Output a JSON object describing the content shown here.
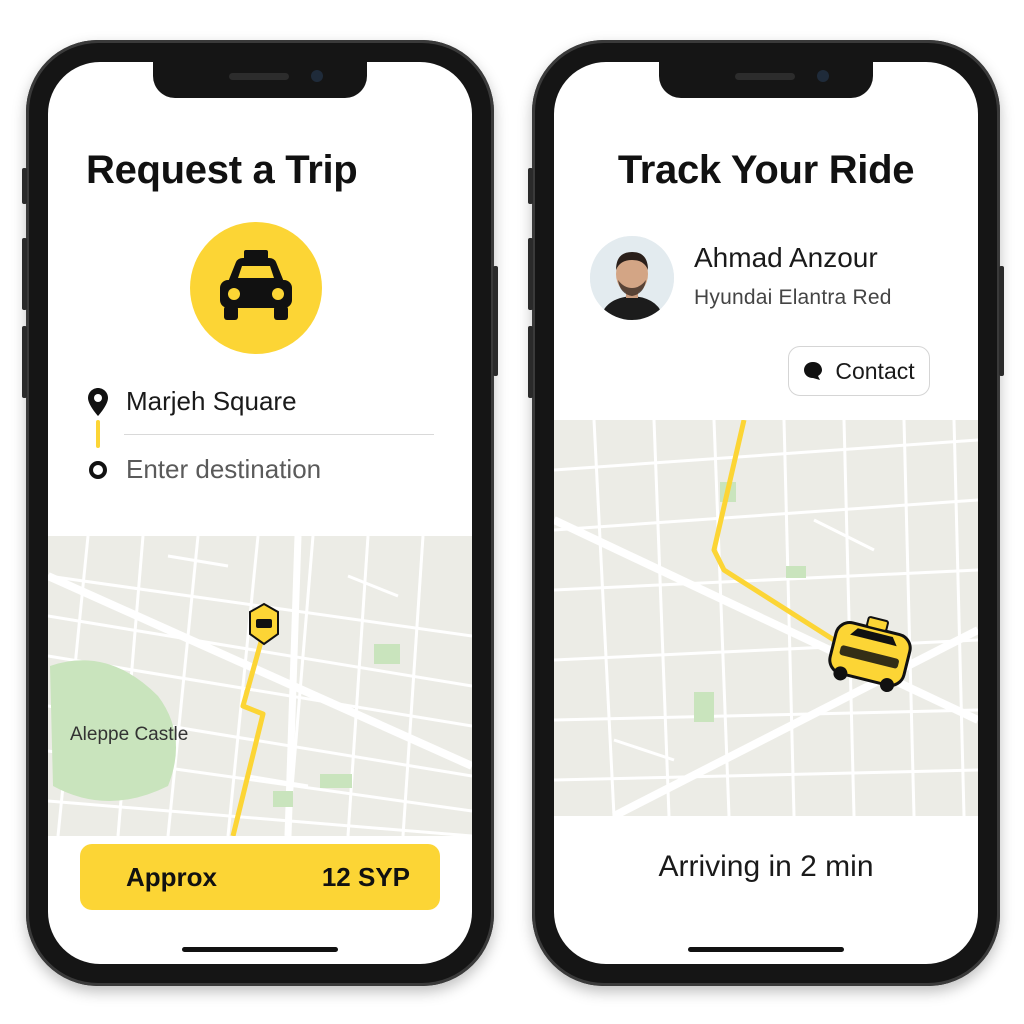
{
  "request_screen": {
    "title": "Request a Trip",
    "pickup": "Marjeh Square",
    "destination_placeholder": "Enter destination",
    "map_landmark": "Aleppe Castle",
    "fare_label": "Approx",
    "fare_value": "12 SYP",
    "taxi_icon": "taxi-icon",
    "pickup_icon": "location-pin-icon",
    "destination_icon": "destination-dot-icon"
  },
  "track_screen": {
    "title": "Track Your Ride",
    "driver_name": "Ahmad Anzour",
    "car_info": "Hyundai Elantra Red",
    "contact_label": "Contact",
    "contact_icon": "chat-bubble-icon",
    "eta": "Arriving in 2 min"
  },
  "colors": {
    "accent": "#fcd535",
    "map_bg": "#ecece6",
    "map_park": "#c9e4bd",
    "text": "#111111"
  }
}
